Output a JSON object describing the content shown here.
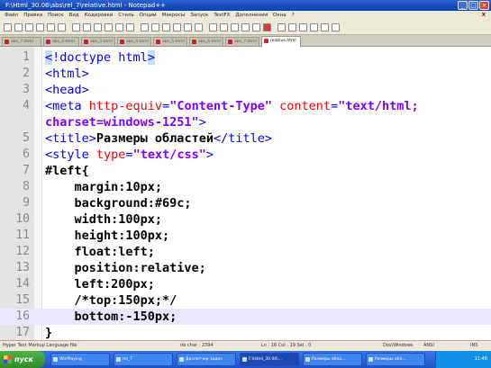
{
  "window": {
    "title": "F:\\Html_30.06\\abs\\rel_7\\relative.html - Notepad++",
    "buttons": [
      "_",
      "□",
      "×"
    ]
  },
  "menu": {
    "items": [
      "Файл",
      "Правка",
      "Поиск",
      "Вид",
      "Кодировки",
      "Стиль",
      "Опции",
      "Макросы",
      "Запуск",
      "TextFX",
      "Дополнения",
      "Окна",
      "?"
    ],
    "close": "X"
  },
  "tabs": [
    {
      "label": "abs_7.html"
    },
    {
      "label": "abs_2.html"
    },
    {
      "label": "abs_3.html"
    },
    {
      "label": "abs_4.html"
    },
    {
      "label": "abs_5.html"
    },
    {
      "label": "abs_6.html"
    },
    {
      "label": "abs_7.html"
    },
    {
      "label": "relative.html",
      "active": true
    }
  ],
  "editor": {
    "current_line": "16",
    "lines": [
      {
        "n": "1",
        "segs": [
          [
            "tag-hl",
            "<"
          ],
          [
            "tag",
            "!doctype html"
          ],
          [
            "tag-hl",
            ">"
          ]
        ]
      },
      {
        "n": "2",
        "segs": [
          [
            "tag",
            "<html>"
          ]
        ]
      },
      {
        "n": "3",
        "segs": [
          [
            "tag",
            "<head>"
          ]
        ]
      },
      {
        "n": "4",
        "segs": [
          [
            "tag",
            "<meta "
          ],
          [
            "atn",
            "http-equiv"
          ],
          [
            "tag",
            "="
          ],
          [
            "atv",
            "\"Content-Type\""
          ],
          [
            "tag",
            " "
          ],
          [
            "atn",
            "content"
          ],
          [
            "tag",
            "="
          ],
          [
            "atv",
            "\"text/html;"
          ]
        ]
      },
      {
        "n": "",
        "segs": [
          [
            "atv",
            "charset=windows-1251\""
          ],
          [
            "tag",
            ">"
          ]
        ]
      },
      {
        "n": "5",
        "segs": [
          [
            "tag",
            "<title>"
          ],
          [
            "txt",
            "Размеры областей"
          ],
          [
            "tag",
            "</title>"
          ]
        ]
      },
      {
        "n": "6",
        "segs": [
          [
            "tag",
            "<style "
          ],
          [
            "atn",
            "type"
          ],
          [
            "tag",
            "="
          ],
          [
            "atv",
            "\"text/css\""
          ],
          [
            "tag",
            ">"
          ]
        ]
      },
      {
        "n": "7",
        "segs": [
          [
            "css",
            "#left{"
          ]
        ]
      },
      {
        "n": "8",
        "segs": [
          [
            "css",
            "    margin:10px;"
          ]
        ]
      },
      {
        "n": "9",
        "segs": [
          [
            "css",
            "    background:#69c;"
          ]
        ]
      },
      {
        "n": "10",
        "segs": [
          [
            "css",
            "    width:100px;"
          ]
        ]
      },
      {
        "n": "11",
        "segs": [
          [
            "css",
            "    height:100px;"
          ]
        ]
      },
      {
        "n": "12",
        "segs": [
          [
            "css",
            "    float:left;"
          ]
        ]
      },
      {
        "n": "13",
        "segs": [
          [
            "css",
            "    position:relative;"
          ]
        ]
      },
      {
        "n": "14",
        "segs": [
          [
            "css",
            "    left:200px;"
          ]
        ]
      },
      {
        "n": "15",
        "segs": [
          [
            "css",
            "    /*top:150px;*/"
          ]
        ]
      },
      {
        "n": "16",
        "segs": [
          [
            "css",
            "    bottom:-150px;"
          ]
        ]
      },
      {
        "n": "17",
        "segs": [
          [
            "css",
            "}"
          ]
        ]
      }
    ]
  },
  "status": {
    "lang": "Hyper Text Markup Language file",
    "chars": "nb char : 2394",
    "pos": "Ln : 16   Col : 19   Sel : 0",
    "eol": "Dos\\Windows",
    "enc": "ANSI",
    "mode": "INS"
  },
  "taskbar": {
    "start": "пуск",
    "buttons": [
      {
        "label": "WinPlaying"
      },
      {
        "label": "rel_7"
      },
      {
        "label": "Диспетчер задач"
      },
      {
        "label": "F:\\Html_30.06\\...",
        "active": true
      },
      {
        "label": "Размеры обла..."
      },
      {
        "label": "Размеры обл..."
      }
    ],
    "clock": "11:46"
  }
}
